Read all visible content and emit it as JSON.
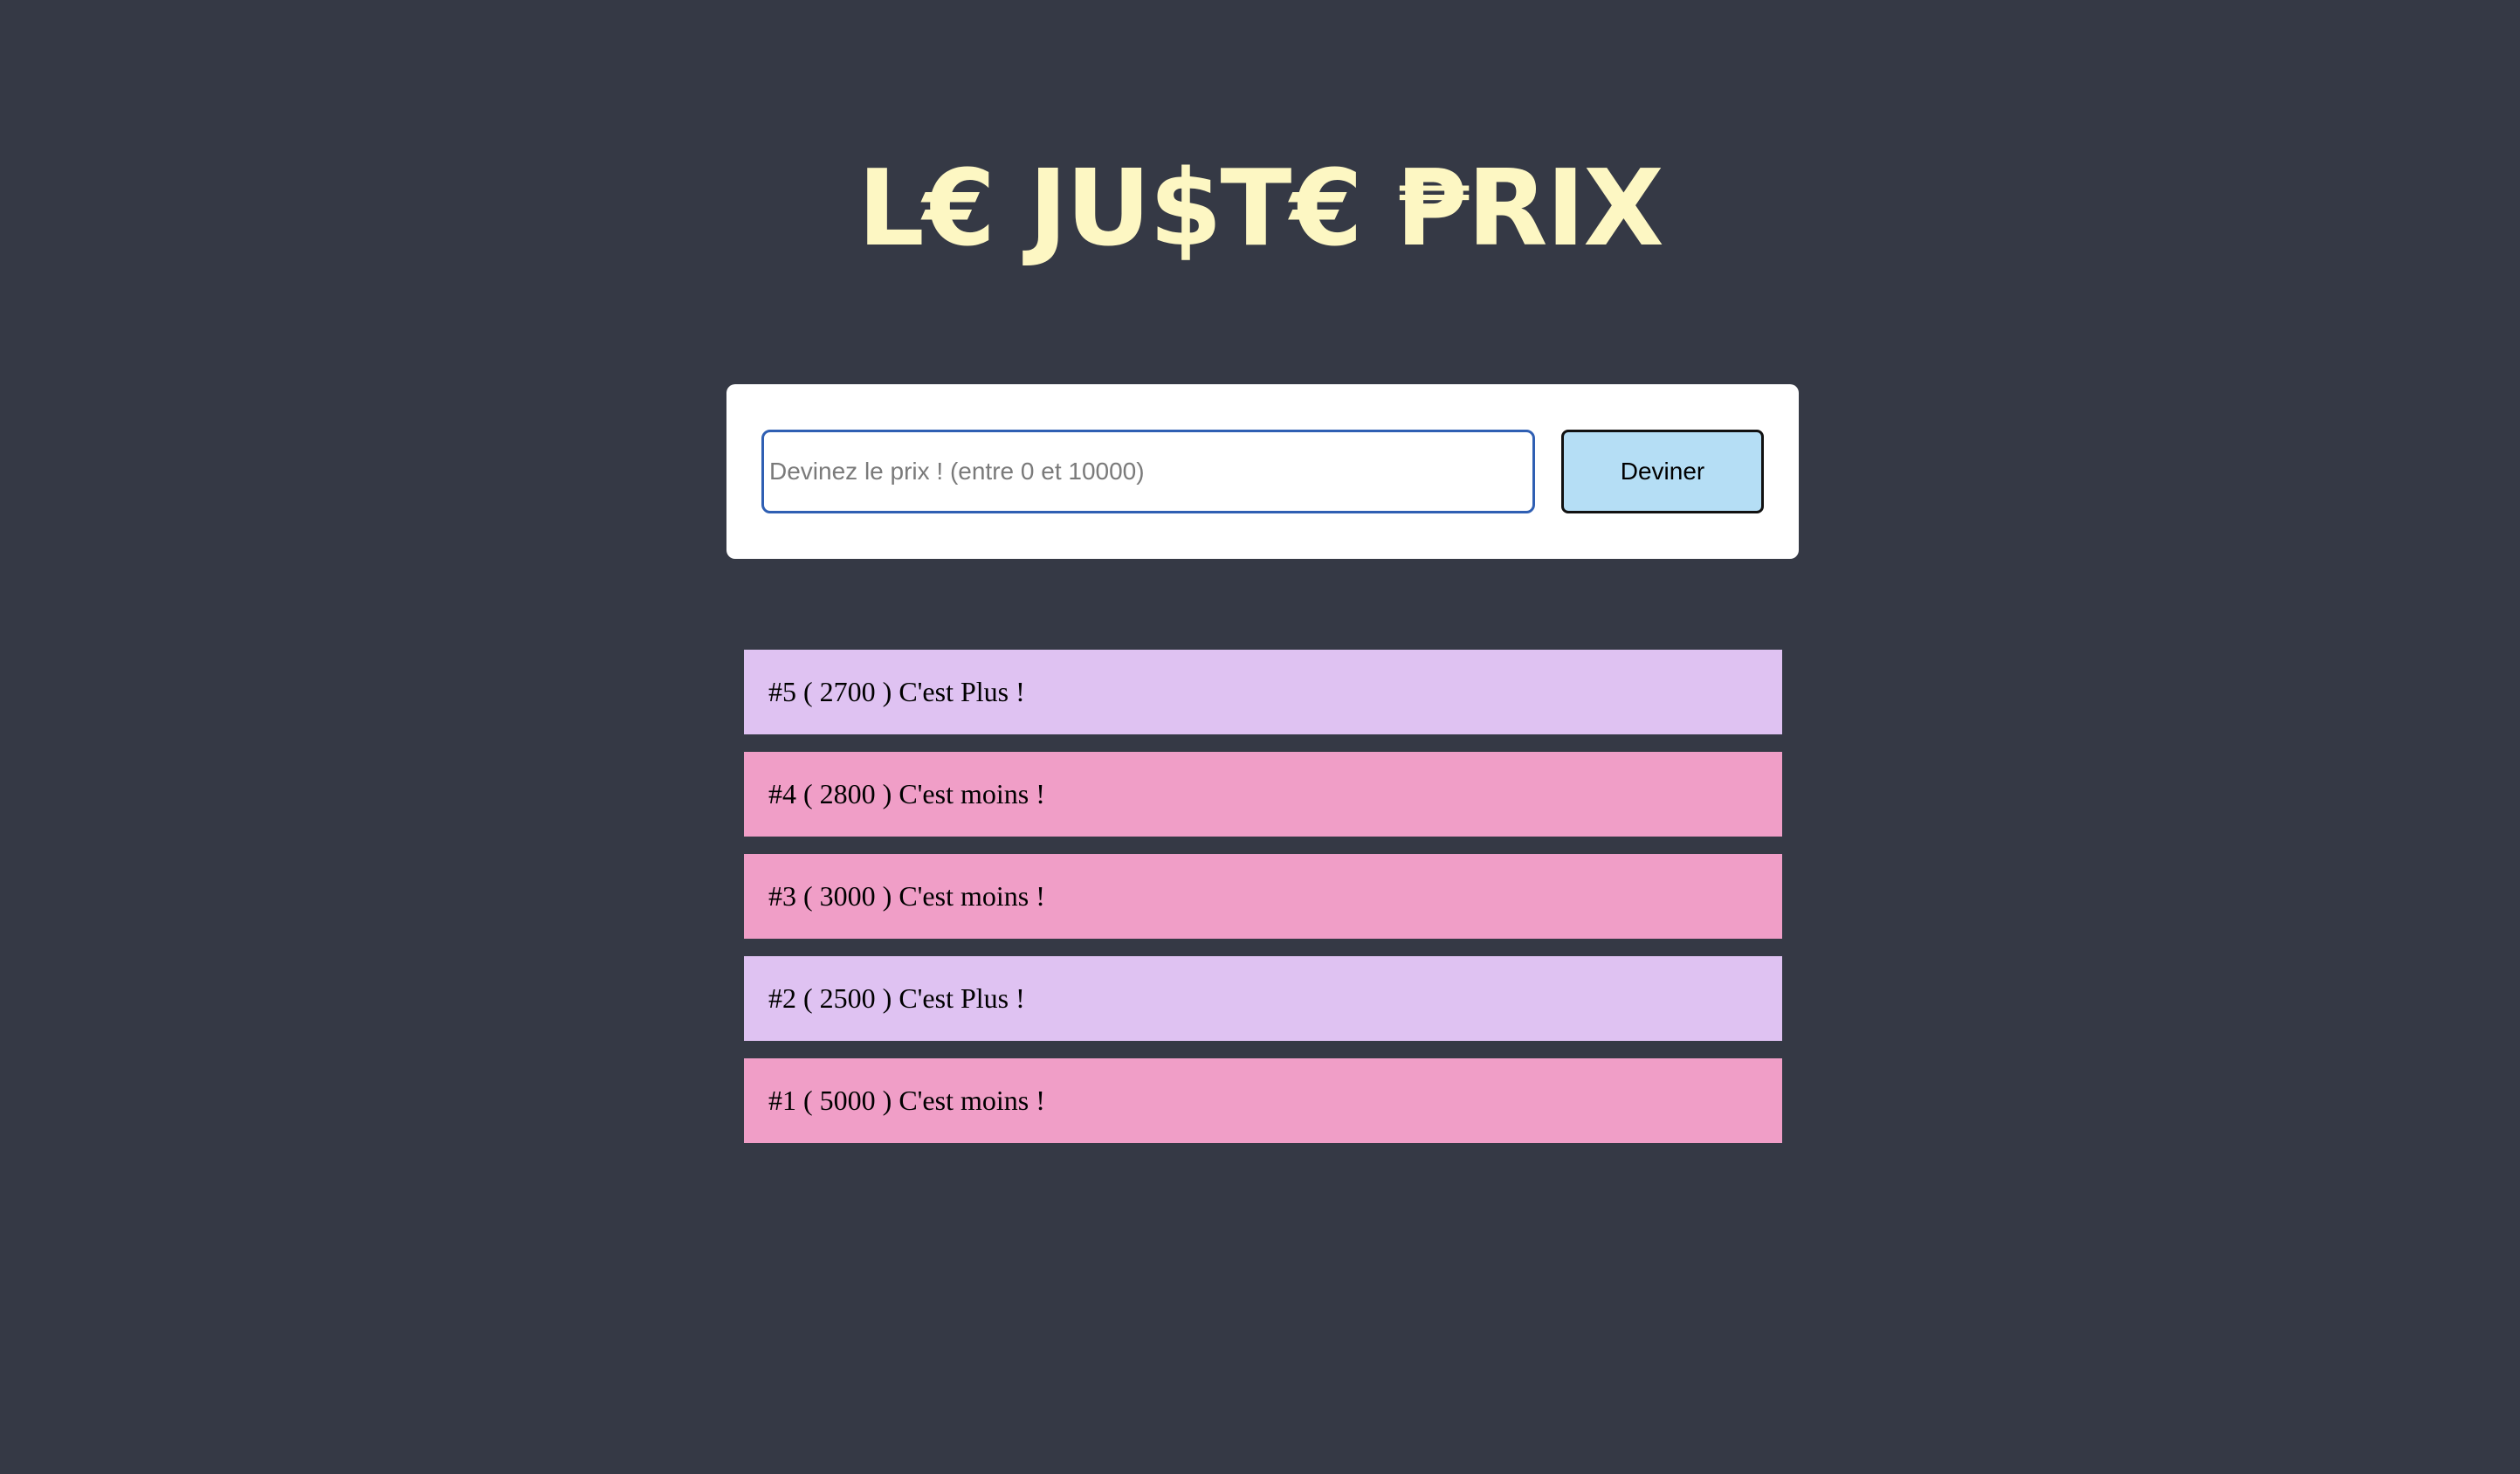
{
  "colors": {
    "background": "#353945",
    "title": "#fdf7c3",
    "card": "#ffffff",
    "input_border": "#2f5fb3",
    "button_bg": "#b5def5",
    "button_border": "#111111",
    "plus": "#dfc2f2",
    "moins": "#f09ec7"
  },
  "title": "L€ JU$T€ ₱RIX",
  "form": {
    "input_value": "",
    "input_placeholder": "Devinez le prix ! (entre 0 et 10000)",
    "button_label": "Deviner"
  },
  "history": [
    {
      "label": "#5 ( 2700 ) C'est Plus !",
      "result": "plus"
    },
    {
      "label": "#4 ( 2800 ) C'est moins !",
      "result": "moins"
    },
    {
      "label": "#3 ( 3000 ) C'est moins !",
      "result": "moins"
    },
    {
      "label": "#2 ( 2500 ) C'est Plus !",
      "result": "plus"
    },
    {
      "label": "#1 ( 5000 ) C'est moins !",
      "result": "moins"
    }
  ]
}
